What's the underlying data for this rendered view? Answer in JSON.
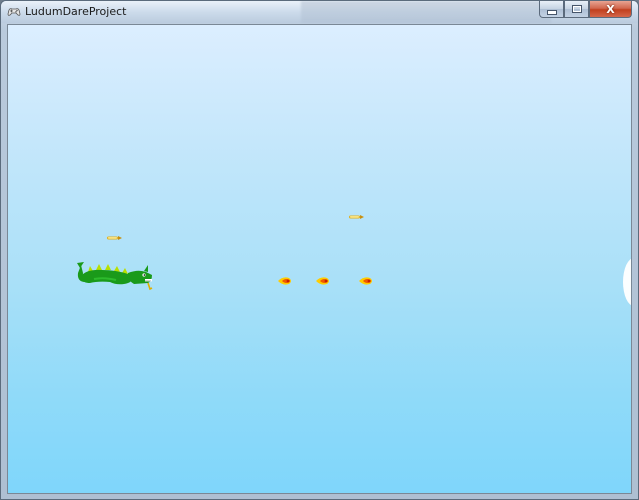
{
  "window": {
    "title": "LudumDareProject",
    "icon": "gamepad-icon",
    "buttons": {
      "minimize": "minimize-icon",
      "maximize": "maximize-icon",
      "close": "close-icon",
      "close_glyph": "X"
    }
  },
  "game": {
    "sky_colors": [
      "#dceeff",
      "#7fd6fb"
    ],
    "player": {
      "type": "green-dragon",
      "color": "#1a9a1a",
      "spike_color": "#b8e000"
    },
    "enemy_fireballs": 3,
    "player_bullets": 2,
    "fireball_colors": [
      "#f05a00",
      "#ffcc00"
    ],
    "bullet_color": "#e0b020"
  }
}
